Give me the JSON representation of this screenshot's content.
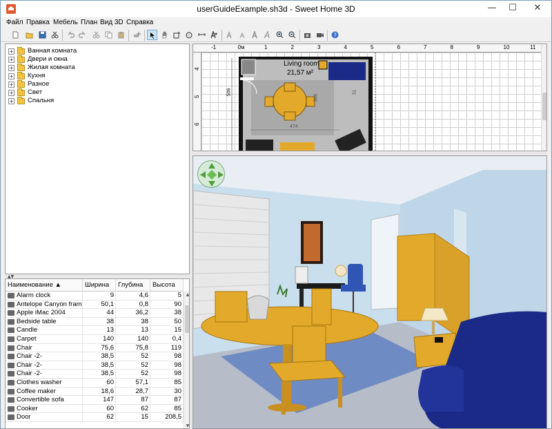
{
  "window": {
    "title": "userGuideExample.sh3d - Sweet Home 3D",
    "minimize_glyph": "—",
    "maximize_glyph": "☐",
    "close_glyph": "✕"
  },
  "menu": {
    "items": [
      "Файл",
      "Правка",
      "Мебель",
      "План",
      "Вид 3D",
      "Справка"
    ]
  },
  "toolbar": {
    "buttons": [
      "new-home",
      "open",
      "save",
      "cut-icon",
      "copy",
      "paste",
      "undo",
      "redo",
      "cut",
      "copy-2",
      "paste-2",
      "add-furniture",
      "select-mode",
      "pan-mode",
      "create-walls",
      "create-rooms",
      "create-dimensions",
      "add-text",
      "text-style-1",
      "text-style-2",
      "text-style-3",
      "text-style-4",
      "zoom-in",
      "zoom-out",
      "create-photo",
      "create-video",
      "help"
    ]
  },
  "catalog": {
    "categories": [
      {
        "label": "Ванная комната"
      },
      {
        "label": "Двери и окна"
      },
      {
        "label": "Жилая комната"
      },
      {
        "label": "Кухня"
      },
      {
        "label": "Разное"
      },
      {
        "label": "Свет"
      },
      {
        "label": "Спальня"
      }
    ],
    "expander_glyph": "+"
  },
  "furniture_table": {
    "columns": {
      "name": "Наименование ▲",
      "width": "Ширина",
      "depth": "Глубина",
      "height": "Высота"
    },
    "rows": [
      {
        "name": "Alarm clock",
        "w": "9",
        "d": "4,6",
        "h": "5"
      },
      {
        "name": "Antelope Canyon frame",
        "w": "50,1",
        "d": "0,8",
        "h": "90"
      },
      {
        "name": "Apple iMac 2004",
        "w": "44",
        "d": "36,2",
        "h": "38"
      },
      {
        "name": "Bedside table",
        "w": "38",
        "d": "38",
        "h": "50"
      },
      {
        "name": "Candle",
        "w": "13",
        "d": "13",
        "h": "15"
      },
      {
        "name": "Carpet",
        "w": "140",
        "d": "140",
        "h": "0,4"
      },
      {
        "name": "Chair",
        "w": "75,6",
        "d": "75,8",
        "h": "119"
      },
      {
        "name": "Chair -2-",
        "w": "38,5",
        "d": "52",
        "h": "98"
      },
      {
        "name": "Chair -2-",
        "w": "38,5",
        "d": "52",
        "h": "98"
      },
      {
        "name": "Chair -2-",
        "w": "38,5",
        "d": "52",
        "h": "98"
      },
      {
        "name": "Clothes washer",
        "w": "60",
        "d": "57,1",
        "h": "85"
      },
      {
        "name": "Coffee maker",
        "w": "18,6",
        "d": "28,7",
        "h": "30"
      },
      {
        "name": "Convertible sofa",
        "w": "147",
        "d": "87",
        "h": "87"
      },
      {
        "name": "Cooker",
        "w": "60",
        "d": "62",
        "h": "85"
      },
      {
        "name": "Door",
        "w": "62",
        "d": "15",
        "h": "208,5"
      }
    ]
  },
  "plan": {
    "ruler_top": [
      "-1",
      "0м",
      "1",
      "2",
      "3",
      "4",
      "5",
      "6",
      "7",
      "8",
      "9",
      "10",
      "11"
    ],
    "ruler_left": [
      "4",
      "5",
      "6",
      "7"
    ],
    "room_name": "Living room",
    "room_area": "21,57 м²",
    "dim_left": "506",
    "dim_bottom": "474",
    "dim_right": "31",
    "dim_mid": "306"
  },
  "scroll": {
    "up": "▲",
    "down": "▼"
  },
  "colors": {
    "wall": "#c5dceb",
    "floor": "#b7bcc9",
    "wood": "#e3a92a",
    "sofa": "#1b2a86",
    "chair": "#2f56b4"
  }
}
